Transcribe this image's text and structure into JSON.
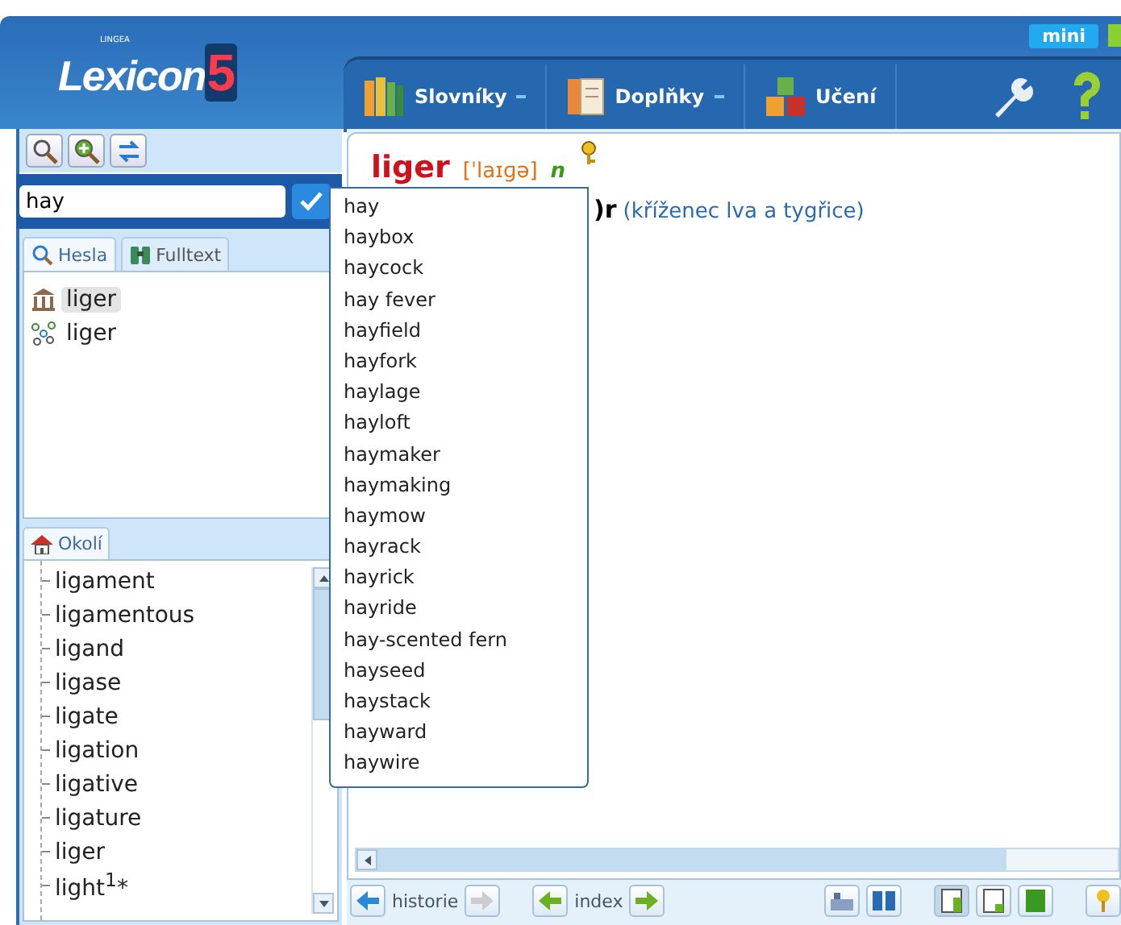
{
  "logo": {
    "brand": "LINGEA",
    "name": "Lexicon",
    "version": "5"
  },
  "mini_button": "mini",
  "menu": [
    {
      "label": "Slovníky",
      "dropdown": true
    },
    {
      "label": "Doplňky",
      "dropdown": true
    },
    {
      "label": "Učení",
      "dropdown": false
    }
  ],
  "search": {
    "value": "hay"
  },
  "search_tabs": [
    {
      "label": "Hesla",
      "selected": true
    },
    {
      "label": "Fulltext",
      "selected": false
    }
  ],
  "results": [
    {
      "word": "liger",
      "selected": true,
      "kind": "dictionary"
    },
    {
      "word": "liger",
      "selected": false,
      "kind": "network"
    }
  ],
  "nearby_tab": {
    "label": "Okolí",
    "selected": true
  },
  "nearby": [
    "ligament",
    "ligamentous",
    "ligand",
    "ligase",
    "ligate",
    "ligation",
    "ligative",
    "ligature",
    "liger",
    "light$^{1}$*"
  ],
  "suggestions": [
    "hay",
    "haybox",
    "haycock",
    "hay fever",
    "hayfield",
    "hayfork",
    "haylage",
    "hayloft",
    "haymaker",
    "haymaking",
    "haymow",
    "hayrack",
    "hayrick",
    "hayride",
    "hay-scented fern",
    "hayseed",
    "haystack",
    "hayward",
    "haywire"
  ],
  "entry": {
    "headword": "liger",
    "pronunciation": "[ˈlaɪɡə]",
    "pos": "n",
    "sense_tail": ")r",
    "sense": "(kříženec lva a tygřice)"
  },
  "bottom_bar": {
    "history": "historie",
    "index": "index"
  }
}
